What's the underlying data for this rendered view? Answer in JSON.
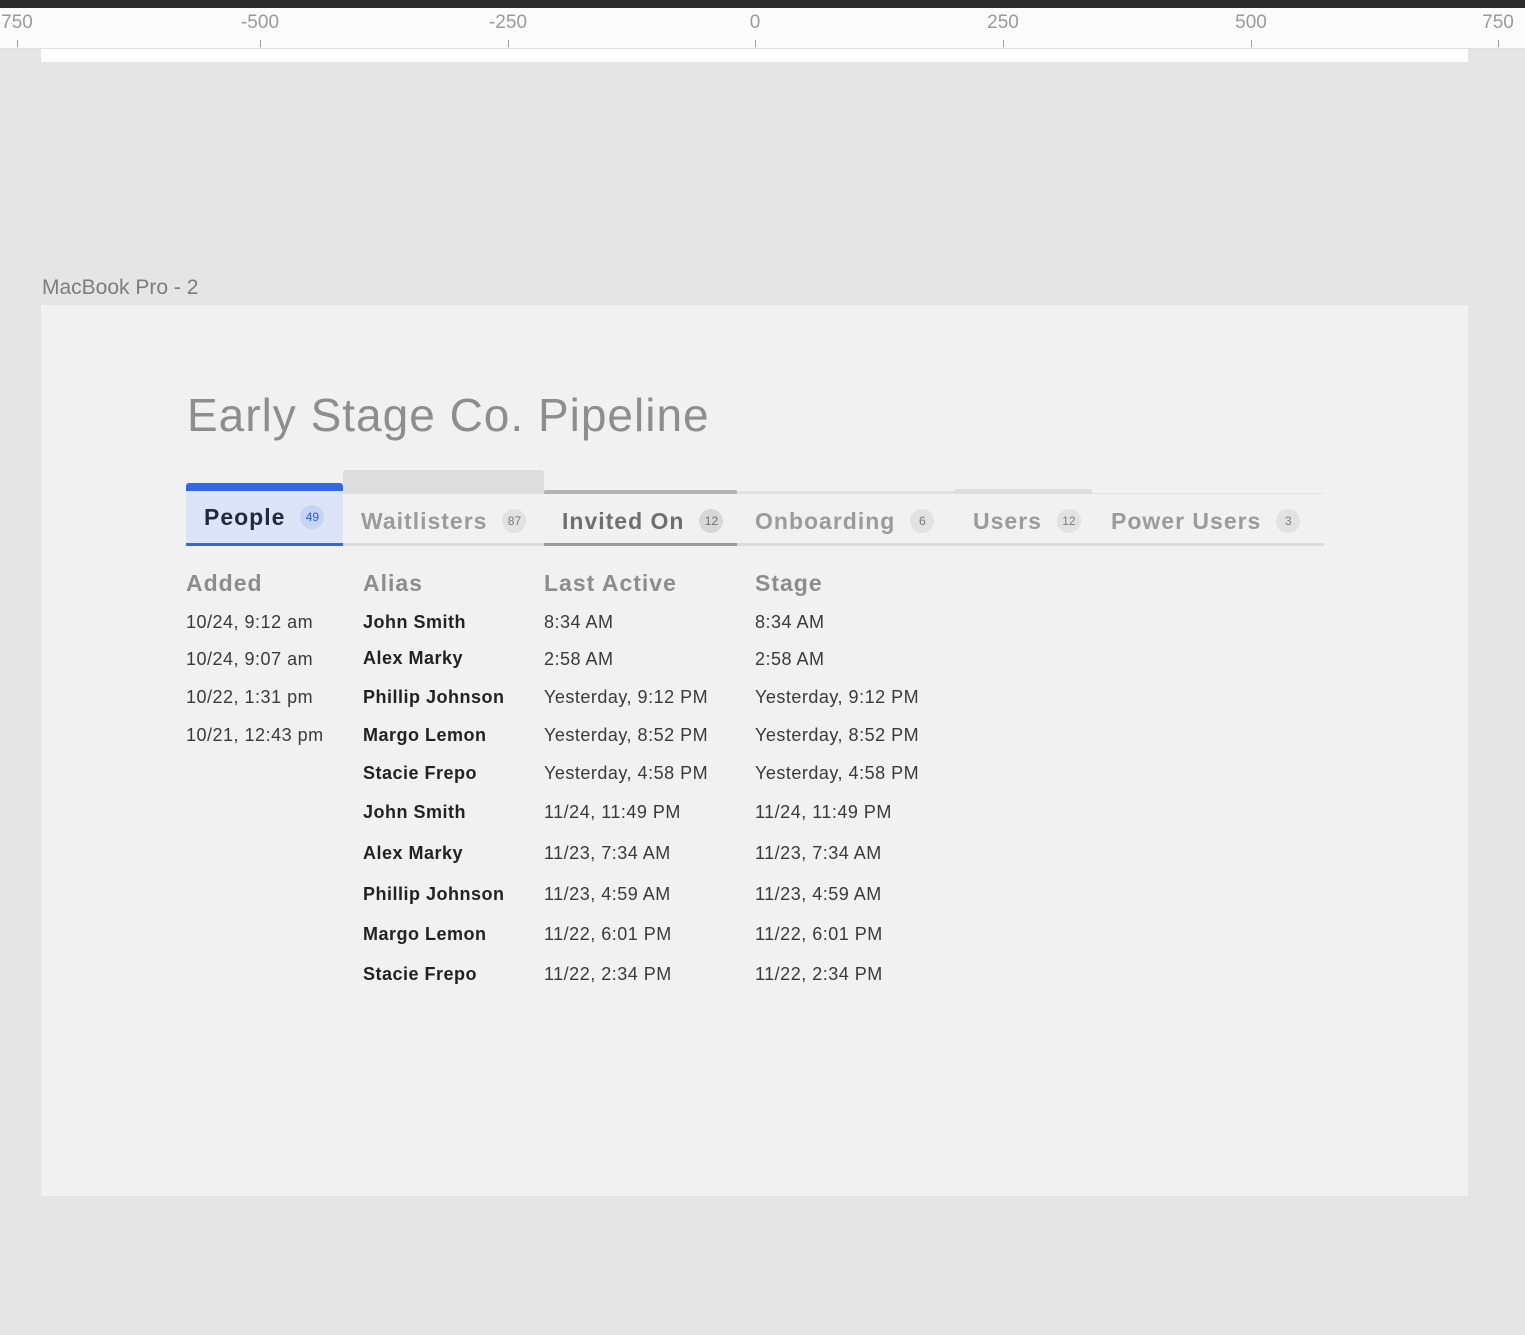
{
  "ruler": {
    "ticks": [
      "750",
      "-500",
      "-250",
      "0",
      "250",
      "500",
      "750"
    ]
  },
  "frame": {
    "label": "MacBook Pro - 2"
  },
  "page": {
    "title": "Early Stage Co. Pipeline"
  },
  "tabs": [
    {
      "label": "People",
      "count": "49",
      "active": true
    },
    {
      "label": "Waitlisters",
      "count": "87",
      "active": false
    },
    {
      "label": "Invited On",
      "count": "12",
      "active": false
    },
    {
      "label": "Onboarding",
      "count": "6",
      "active": false
    },
    {
      "label": "Users",
      "count": "12",
      "active": false
    },
    {
      "label": "Power Users",
      "count": "3",
      "active": false
    }
  ],
  "table": {
    "headers": [
      "Added",
      "Alias",
      "Last Active",
      "Stage"
    ],
    "added": [
      "10/24, 9:12 am",
      "10/24, 9:07 am",
      "10/22, 1:31 pm",
      "10/21, 12:43 pm"
    ],
    "alias": [
      "John Smith",
      "Alex Marky",
      "Phillip Johnson",
      "Margo Lemon",
      "Stacie Frepo",
      "John Smith",
      "Alex Marky",
      "Phillip Johnson",
      "Margo Lemon",
      "Stacie Frepo"
    ],
    "last_active": [
      "8:34 AM",
      "2:58 AM",
      "Yesterday, 9:12 PM",
      "Yesterday, 8:52 PM",
      "Yesterday, 4:58 PM",
      "11/24, 11:49 PM",
      "11/23, 7:34 AM",
      "11/23, 4:59 AM",
      "11/22, 6:01 PM",
      "11/22, 2:34 PM"
    ],
    "stage": [
      "8:34 AM",
      "2:58 AM",
      "Yesterday, 9:12 PM",
      "Yesterday, 8:52 PM",
      "Yesterday, 4:58 PM",
      "11/24, 11:49 PM",
      "11/23, 7:34 AM",
      "11/23, 4:59 AM",
      "11/22, 6:01 PM",
      "11/22, 2:34 PM"
    ]
  },
  "colors": {
    "accent": "#3268e6",
    "active_tab_bg": "#dde4f7",
    "frame_bg": "#f1f1f1",
    "canvas_bg": "#e5e5e5"
  }
}
